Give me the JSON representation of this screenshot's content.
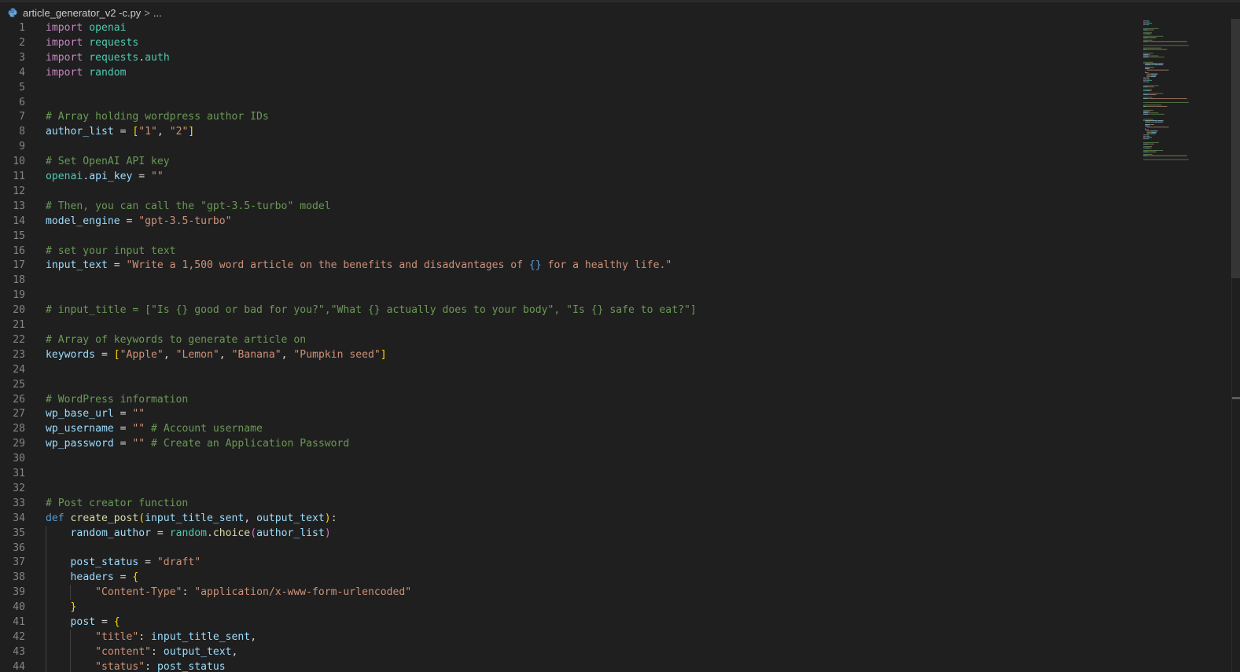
{
  "breadcrumb": {
    "file_icon": "python-file-icon",
    "filename": "article_generator_v2 -c.py",
    "separator": ">",
    "more": "..."
  },
  "editor": {
    "lines": [
      [
        [
          "kw",
          "import"
        ],
        [
          "pl",
          " "
        ],
        [
          "mod",
          "openai"
        ]
      ],
      [
        [
          "kw",
          "import"
        ],
        [
          "pl",
          " "
        ],
        [
          "mod",
          "requests"
        ]
      ],
      [
        [
          "kw",
          "import"
        ],
        [
          "pl",
          " "
        ],
        [
          "mod",
          "requests"
        ],
        [
          "op",
          "."
        ],
        [
          "mod",
          "auth"
        ]
      ],
      [
        [
          "kw",
          "import"
        ],
        [
          "pl",
          " "
        ],
        [
          "mod",
          "random"
        ]
      ],
      [],
      [],
      [
        [
          "com",
          "# Array holding wordpress author IDs"
        ]
      ],
      [
        [
          "var",
          "author_list"
        ],
        [
          "op",
          " = "
        ],
        [
          "br1",
          "["
        ],
        [
          "str",
          "\"1\""
        ],
        [
          "op",
          ", "
        ],
        [
          "str",
          "\"2\""
        ],
        [
          "br1",
          "]"
        ]
      ],
      [],
      [
        [
          "com",
          "# Set OpenAI API key"
        ]
      ],
      [
        [
          "mod",
          "openai"
        ],
        [
          "op",
          "."
        ],
        [
          "var",
          "api_key"
        ],
        [
          "op",
          " = "
        ],
        [
          "str",
          "\"\""
        ]
      ],
      [],
      [
        [
          "com",
          "# Then, you can call the \"gpt-3.5-turbo\" model"
        ]
      ],
      [
        [
          "var",
          "model_engine"
        ],
        [
          "op",
          " = "
        ],
        [
          "str",
          "\"gpt-3.5-turbo\""
        ]
      ],
      [],
      [
        [
          "com",
          "# set your input text"
        ]
      ],
      [
        [
          "var",
          "input_text"
        ],
        [
          "op",
          " = "
        ],
        [
          "str",
          "\"Write a 1,500 word article on the benefits and disadvantages of "
        ],
        [
          "def",
          "{}"
        ],
        [
          "str",
          " for a healthy life.\""
        ]
      ],
      [],
      [],
      [
        [
          "com",
          "# input_title = [\"Is {} good or bad for you?\",\"What {} actually does to your body\", \"Is {} safe to eat?\"]"
        ]
      ],
      [],
      [
        [
          "com",
          "# Array of keywords to generate article on"
        ]
      ],
      [
        [
          "var",
          "keywords"
        ],
        [
          "op",
          " = "
        ],
        [
          "br1",
          "["
        ],
        [
          "str",
          "\"Apple\""
        ],
        [
          "op",
          ", "
        ],
        [
          "str",
          "\"Lemon\""
        ],
        [
          "op",
          ", "
        ],
        [
          "str",
          "\"Banana\""
        ],
        [
          "op",
          ", "
        ],
        [
          "str",
          "\"Pumpkin seed\""
        ],
        [
          "br1",
          "]"
        ]
      ],
      [],
      [],
      [
        [
          "com",
          "# WordPress information"
        ]
      ],
      [
        [
          "var",
          "wp_base_url"
        ],
        [
          "op",
          " = "
        ],
        [
          "str",
          "\"\""
        ]
      ],
      [
        [
          "var",
          "wp_username"
        ],
        [
          "op",
          " = "
        ],
        [
          "str",
          "\"\""
        ],
        [
          "pl",
          " "
        ],
        [
          "com",
          "# Account username"
        ]
      ],
      [
        [
          "var",
          "wp_password"
        ],
        [
          "op",
          " = "
        ],
        [
          "str",
          "\"\""
        ],
        [
          "pl",
          " "
        ],
        [
          "com",
          "# Create an Application Password"
        ]
      ],
      [],
      [],
      [],
      [
        [
          "com",
          "# Post creator function"
        ]
      ],
      [
        [
          "def",
          "def"
        ],
        [
          "pl",
          " "
        ],
        [
          "fn",
          "create_post"
        ],
        [
          "br1",
          "("
        ],
        [
          "var",
          "input_title_sent"
        ],
        [
          "op",
          ", "
        ],
        [
          "var",
          "output_text"
        ],
        [
          "br1",
          ")"
        ],
        [
          "op",
          ":"
        ]
      ],
      [
        [
          "pl",
          "    "
        ],
        [
          "var",
          "random_author"
        ],
        [
          "op",
          " = "
        ],
        [
          "mod",
          "random"
        ],
        [
          "op",
          "."
        ],
        [
          "fn",
          "choice"
        ],
        [
          "br2",
          "("
        ],
        [
          "var",
          "author_list"
        ],
        [
          "br2",
          ")"
        ]
      ],
      [],
      [
        [
          "pl",
          "    "
        ],
        [
          "var",
          "post_status"
        ],
        [
          "op",
          " = "
        ],
        [
          "str",
          "\"draft\""
        ]
      ],
      [
        [
          "pl",
          "    "
        ],
        [
          "var",
          "headers"
        ],
        [
          "op",
          " = "
        ],
        [
          "br1",
          "{"
        ]
      ],
      [
        [
          "pl",
          "        "
        ],
        [
          "str",
          "\"Content-Type\""
        ],
        [
          "op",
          ": "
        ],
        [
          "str",
          "\"application/x-www-form-urlencoded\""
        ]
      ],
      [
        [
          "pl",
          "    "
        ],
        [
          "br1",
          "}"
        ]
      ],
      [
        [
          "pl",
          "    "
        ],
        [
          "var",
          "post"
        ],
        [
          "op",
          " = "
        ],
        [
          "br1",
          "{"
        ]
      ],
      [
        [
          "pl",
          "        "
        ],
        [
          "str",
          "\"title\""
        ],
        [
          "op",
          ": "
        ],
        [
          "var",
          "input_title_sent"
        ],
        [
          "op",
          ","
        ]
      ],
      [
        [
          "pl",
          "        "
        ],
        [
          "str",
          "\"content\""
        ],
        [
          "op",
          ": "
        ],
        [
          "var",
          "output_text"
        ],
        [
          "op",
          ","
        ]
      ],
      [
        [
          "pl",
          "        "
        ],
        [
          "str",
          "\"status\""
        ],
        [
          "op",
          ": "
        ],
        [
          "var",
          "post_status"
        ]
      ]
    ]
  },
  "colors": {
    "background": "#1f1f1f",
    "line_number": "#858585",
    "keyword": "#c586c0",
    "string": "#ce9178",
    "comment": "#6a9955",
    "function": "#dcdcaa",
    "variable": "#9cdcfe"
  }
}
